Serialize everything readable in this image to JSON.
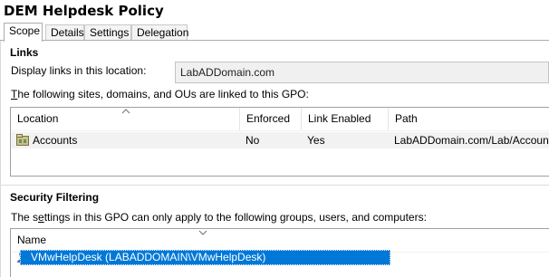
{
  "window": {
    "title": "DEM Helpdesk Policy"
  },
  "tabs": [
    {
      "label": "Scope",
      "active": true
    },
    {
      "label": "Details",
      "active": false
    },
    {
      "label": "Settings",
      "active": false
    },
    {
      "label": "Delegation",
      "active": false
    }
  ],
  "links": {
    "section_title": "Links",
    "display_label": "Display links in this location:",
    "location_value": "LabADDomain.com",
    "description": "The following sites, domains, and OUs are linked to this GPO:",
    "columns": [
      "Location",
      "Enforced",
      "Link Enabled",
      "Path"
    ],
    "rows": [
      {
        "location": "Accounts",
        "enforced": "No",
        "link_enabled": "Yes",
        "path": "LabADDomain.com/Lab/Accounts",
        "icon": "ou-folder-icon"
      }
    ]
  },
  "security": {
    "section_title": "Security Filtering",
    "description": "The settings in this GPO can only apply to the following groups, users, and computers:",
    "column": "Name",
    "rows": [
      {
        "name": "VMwHelpDesk (LABADDOMAIN\\VMwHelpDesk)",
        "selected": true,
        "icon": "user-group-icon"
      }
    ]
  },
  "colors": {
    "selection": "#0078d7",
    "header_bg": "#f0f0f0"
  }
}
